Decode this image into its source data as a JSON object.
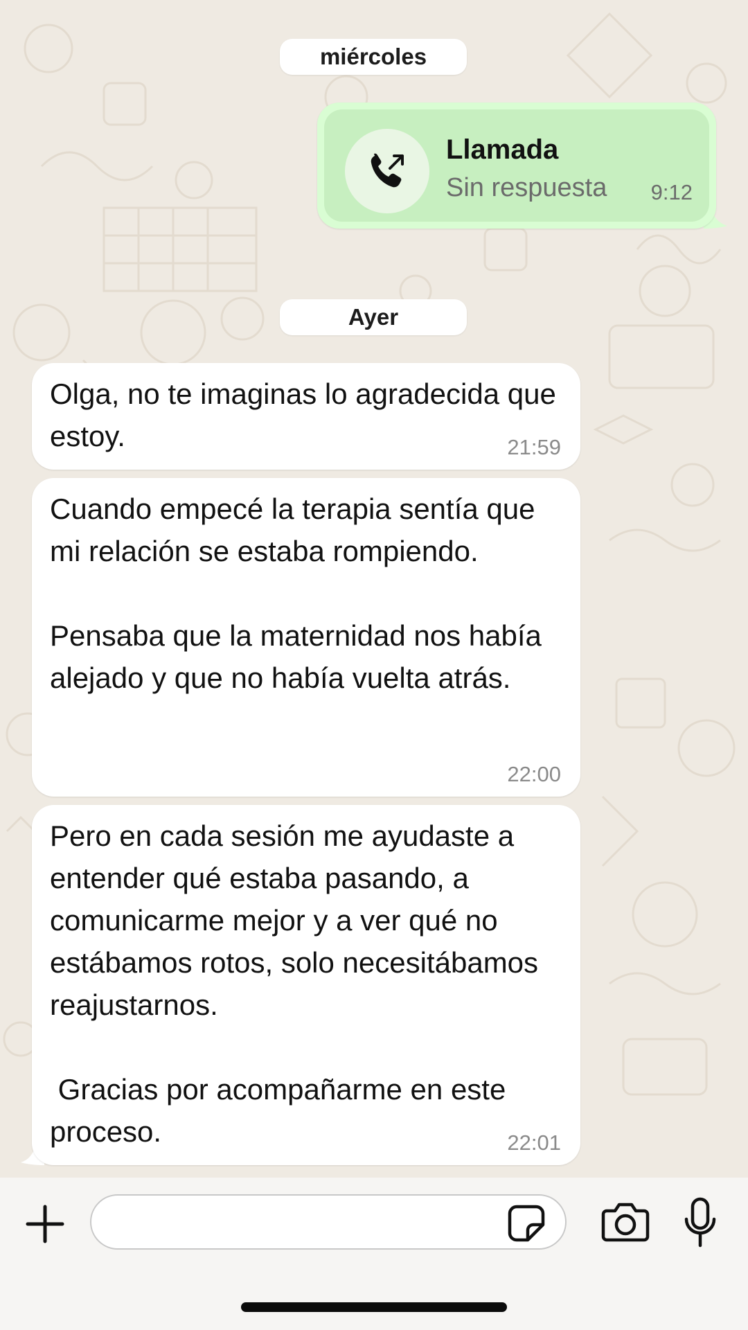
{
  "chat": {
    "separators": {
      "first": "miércoles",
      "second": "Ayer"
    },
    "call": {
      "title": "Llamada",
      "status": "Sin respuesta",
      "time": "9:12",
      "icon": "outgoing-call-icon"
    },
    "messages": [
      {
        "text": "Olga, no te imaginas lo agradecida que estoy.",
        "time": "21:59"
      },
      {
        "text": "Cuando empecé la terapia sentía que mi relación se estaba rompiendo.\n\nPensaba que la maternidad nos había alejado y que no había vuelta atrás.",
        "time": "22:00"
      },
      {
        "text": "Pero en cada sesión me ayudaste a entender qué estaba pasando, a comunicarme mejor y a ver qué no estábamos rotos, solo necesitábamos reajustarnos.\n\n Gracias por acompañarme en este proceso.",
        "time": "22:01"
      }
    ]
  },
  "input_bar": {
    "message_value": "",
    "icons": [
      "plus-icon",
      "sticker-icon",
      "camera-icon",
      "microphone-icon"
    ]
  },
  "colors": {
    "chat_background": "#efeae2",
    "outgoing_bubble": "#d9fdd3",
    "incoming_bubble": "#ffffff"
  }
}
